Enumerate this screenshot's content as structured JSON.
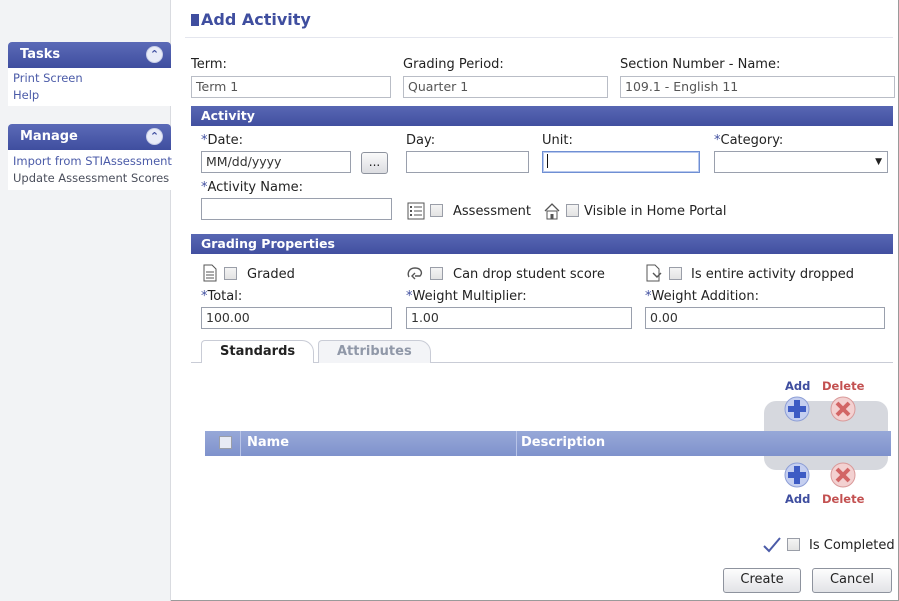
{
  "page": {
    "title": "Add Activity"
  },
  "sidebar": {
    "tasks": {
      "title": "Tasks",
      "links": [
        "Print Screen",
        "Help"
      ]
    },
    "manage": {
      "title": "Manage",
      "links": [
        "Import from STIAssessment",
        "Update Assessment Scores"
      ]
    }
  },
  "header_fields": {
    "term_label": "Term:",
    "term_value": "Term 1",
    "grading_period_label": "Grading Period:",
    "grading_period_value": "Quarter 1",
    "section_label": "Section Number - Name:",
    "section_value": "109.1 - English 11"
  },
  "activity": {
    "section_title": "Activity",
    "date_label": "Date:",
    "date_value": "MM/dd/yyyy",
    "date_button": "...",
    "day_label": "Day:",
    "day_value": "",
    "unit_label": "Unit:",
    "unit_value": "",
    "category_label": "Category:",
    "category_value": "",
    "activity_name_label": "Activity Name:",
    "activity_name_value": "",
    "assessment_label": "Assessment",
    "visible_label": "Visible in Home Portal",
    "required_marker": "*"
  },
  "grading": {
    "section_title": "Grading Properties",
    "graded_label": "Graded",
    "drop_score_label": "Can drop student score",
    "entire_dropped_label": "Is entire activity dropped",
    "total_label": "Total:",
    "total_value": "100.00",
    "weight_mult_label": "Weight Multiplier:",
    "weight_mult_value": "1.00",
    "weight_add_label": "Weight Addition:",
    "weight_add_value": "0.00"
  },
  "tabs": [
    {
      "label": "Standards",
      "active": true
    },
    {
      "label": "Attributes",
      "active": false
    }
  ],
  "standards_grid": {
    "add_label": "Add",
    "delete_label": "Delete",
    "columns": [
      "Name",
      "Description"
    ],
    "rows": []
  },
  "footer": {
    "completed_label": "Is Completed",
    "create_button": "Create",
    "cancel_button": "Cancel"
  },
  "colors": {
    "accent": "#3f4e9f",
    "grid_header": "#8a9bd2",
    "delete_red": "#c35151"
  }
}
